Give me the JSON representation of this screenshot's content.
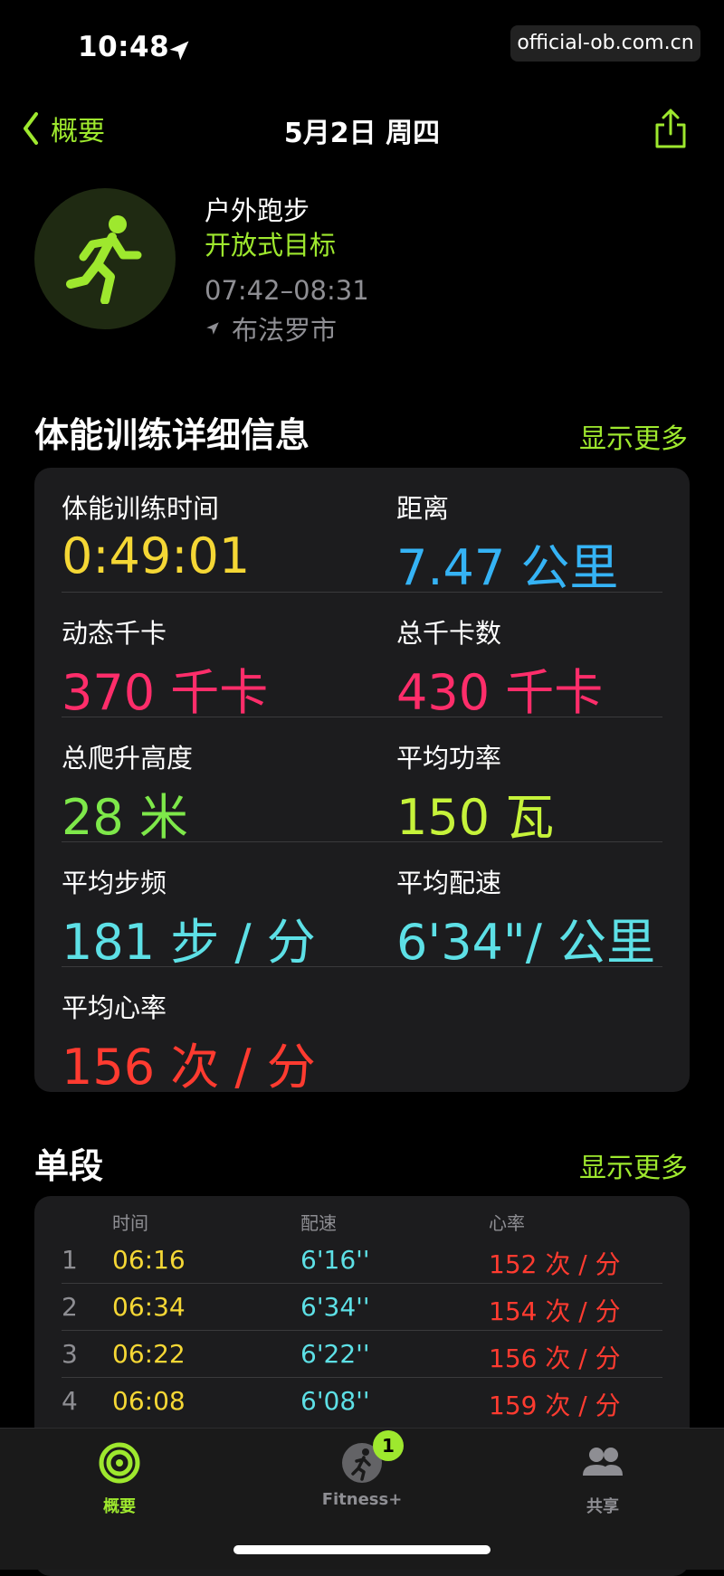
{
  "status_bar": {
    "time": "10:48",
    "watermark": "official-ob.com.cn"
  },
  "nav": {
    "back_label": "概要",
    "title": "5月2日 周四"
  },
  "workout": {
    "type": "户外跑步",
    "goal": "开放式目标",
    "time_range": "07:42–08:31",
    "location": "布法罗市"
  },
  "details_section": {
    "title": "体能训练详细信息",
    "show_more": "显示更多",
    "metrics": [
      {
        "label": "体能训练时间",
        "value": "0:49:01",
        "color": "#f5d735"
      },
      {
        "label": "距离",
        "value": "7.47 公里",
        "color": "#35b3f5"
      },
      {
        "label": "动态千卡",
        "value": "370 千卡",
        "color": "#ff2d6a"
      },
      {
        "label": "总千卡数",
        "value": "430 千卡",
        "color": "#ff2d6a"
      },
      {
        "label": "总爬升高度",
        "value": "28 米",
        "color": "#7ee84a"
      },
      {
        "label": "平均功率",
        "value": "150 瓦",
        "color": "#c6f33a"
      },
      {
        "label": "平均步频",
        "value": "181 步 / 分",
        "color": "#5de0e6"
      },
      {
        "label": "平均配速",
        "value": "6'34\"/ 公里",
        "color": "#5de0e6"
      },
      {
        "label": "平均心率",
        "value": "156 次 / 分",
        "color": "#ff3b30"
      }
    ]
  },
  "splits_section": {
    "title": "单段",
    "show_more": "显示更多",
    "headers": {
      "time": "时间",
      "pace": "配速",
      "heart_rate": "心率"
    },
    "rows": [
      {
        "index": "1",
        "time": "06:16",
        "pace": "6'16''",
        "heart_rate": "152 次 / 分"
      },
      {
        "index": "2",
        "time": "06:34",
        "pace": "6'34''",
        "heart_rate": "154 次 / 分"
      },
      {
        "index": "3",
        "time": "06:22",
        "pace": "6'22''",
        "heart_rate": "156 次 / 分"
      },
      {
        "index": "4",
        "time": "06:08",
        "pace": "6'08''",
        "heart_rate": "159 次 / 分"
      }
    ]
  },
  "tabbar": {
    "tabs": [
      {
        "label": "概要",
        "active": true
      },
      {
        "label": "Fitness+",
        "badge": "1"
      },
      {
        "label": "共享"
      }
    ]
  },
  "colors": {
    "accent": "#9ee82e",
    "background": "#000000",
    "card": "#1c1c1e"
  }
}
